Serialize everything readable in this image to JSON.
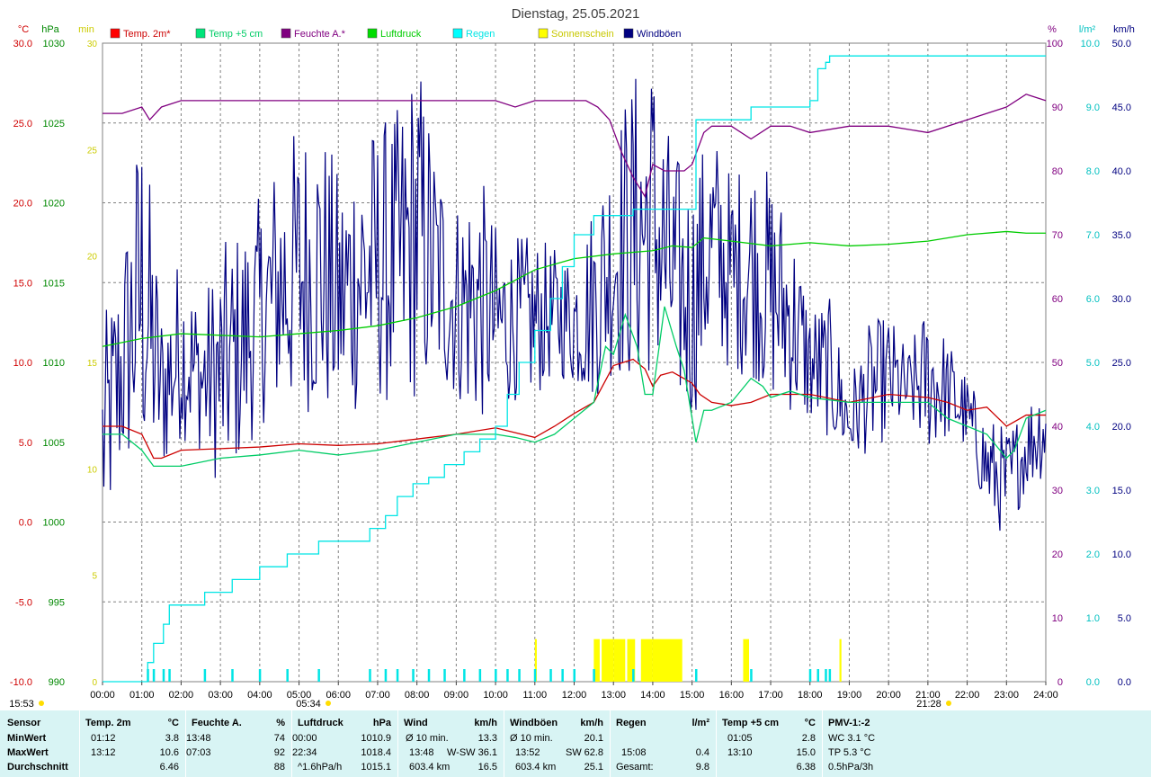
{
  "chart_data": {
    "type": "line",
    "title": "Dienstag, 25.05.2021",
    "x_ticks": [
      "00:00",
      "01:00",
      "02:00",
      "03:00",
      "04:00",
      "05:00",
      "06:00",
      "07:00",
      "08:00",
      "09:00",
      "10:00",
      "11:00",
      "12:00",
      "13:00",
      "14:00",
      "15:00",
      "16:00",
      "17:00",
      "18:00",
      "19:00",
      "20:00",
      "21:00",
      "22:00",
      "23:00",
      "24:00"
    ],
    "x_range_hours": [
      0,
      24
    ],
    "grid": true,
    "legend_placement": "top",
    "axes": {
      "temp": {
        "unit": "°C",
        "range": [
          -10,
          30
        ],
        "ticks": [
          "30.0",
          "25.0",
          "20.0",
          "15.0",
          "10.0",
          "5.0",
          "0.0",
          "-5.0",
          "-10.0"
        ],
        "color": "#ff0000"
      },
      "pressure": {
        "unit": "hPa",
        "range": [
          990,
          1030
        ],
        "ticks": [
          "1030",
          "1025",
          "1020",
          "1015",
          "1010",
          "1005",
          "1000",
          "995",
          "990"
        ],
        "color": "#00aa00"
      },
      "sun_min": {
        "unit": "min",
        "range": [
          0,
          30
        ],
        "ticks": [
          "30",
          "25",
          "20",
          "15",
          "10",
          "5",
          "0"
        ],
        "color": "#dddd00"
      },
      "humidity": {
        "unit": "%",
        "range": [
          0,
          100
        ],
        "ticks": [
          "100",
          "90",
          "80",
          "70",
          "60",
          "50",
          "40",
          "30",
          "20",
          "10",
          "0"
        ],
        "color": "#800080"
      },
      "rain": {
        "unit": "l/m²",
        "range": [
          0,
          10
        ],
        "ticks": [
          "10.0",
          "9.0",
          "8.0",
          "7.0",
          "6.0",
          "5.0",
          "4.0",
          "3.0",
          "2.0",
          "1.0",
          "0.0"
        ],
        "color": "#00cccc"
      },
      "wind": {
        "unit": "km/h",
        "range": [
          0,
          50
        ],
        "ticks": [
          "50.0",
          "45.0",
          "40.0",
          "35.0",
          "30.0",
          "25.0",
          "20.0",
          "15.0",
          "10.0",
          "5.0",
          "0.0"
        ],
        "color": "#000080"
      }
    },
    "series": [
      {
        "name": "Temp. 2m*",
        "color": "#cc0000",
        "axis": "temp",
        "x": [
          0,
          0.5,
          1,
          1.3,
          1.5,
          2,
          3,
          4,
          5,
          6,
          7,
          8,
          9,
          10,
          10.5,
          11,
          11.5,
          12,
          12.5,
          13,
          13.5,
          13.8,
          14,
          14.2,
          14.5,
          15,
          15.2,
          15.5,
          16,
          16.5,
          17,
          17.5,
          18,
          19,
          20,
          21,
          21.5,
          22,
          22.5,
          23,
          23.5,
          24
        ],
        "y": [
          6.0,
          6.0,
          5.5,
          4.0,
          4.0,
          4.5,
          4.6,
          4.7,
          4.9,
          4.8,
          4.9,
          5.2,
          5.5,
          5.9,
          5.6,
          5.3,
          6.0,
          6.8,
          7.5,
          9.8,
          10.2,
          9.6,
          8.5,
          9.2,
          9.4,
          8.7,
          8.0,
          7.5,
          7.3,
          7.5,
          8.0,
          8.0,
          8.0,
          7.5,
          8.0,
          7.8,
          7.5,
          7.0,
          7.2,
          6.0,
          6.7,
          6.7
        ]
      },
      {
        "name": "Temp +5 cm",
        "color": "#00cc66",
        "axis": "temp",
        "x": [
          0,
          0.5,
          1,
          1.3,
          2,
          3,
          4,
          5,
          6,
          7,
          8,
          9,
          10,
          10.5,
          11,
          11.5,
          12,
          12.5,
          12.8,
          13,
          13.3,
          13.6,
          13.8,
          14,
          14.3,
          14.6,
          14.8,
          15,
          15.1,
          15.3,
          15.5,
          16,
          16.5,
          16.8,
          17,
          17.5,
          18,
          19,
          20,
          21,
          21.5,
          22,
          22.5,
          23,
          23.2,
          23.5,
          24
        ],
        "y": [
          5.5,
          5.5,
          4.5,
          3.5,
          3.5,
          4.0,
          4.2,
          4.5,
          4.2,
          4.5,
          5.0,
          5.5,
          5.5,
          5.3,
          5.0,
          5.5,
          6.5,
          7.5,
          11.0,
          10.5,
          13.0,
          11.0,
          8.0,
          8.0,
          13.5,
          11.0,
          9.5,
          6.5,
          5.0,
          7.0,
          7.0,
          7.5,
          9.0,
          8.5,
          7.8,
          8.2,
          7.8,
          7.5,
          7.5,
          7.5,
          6.5,
          6.0,
          5.5,
          4.0,
          4.5,
          6.5,
          7.0
        ]
      },
      {
        "name": "Feuchte A.*",
        "color": "#800080",
        "axis": "humidity",
        "x": [
          0,
          0.5,
          1,
          1.2,
          1.5,
          2,
          3,
          4,
          5,
          6,
          7,
          8,
          9,
          10,
          10.5,
          11,
          12,
          12.3,
          12.6,
          12.9,
          13.2,
          13.5,
          13.8,
          14,
          14.3,
          14.6,
          14.8,
          15,
          15.3,
          15.5,
          16,
          16.5,
          17,
          17.5,
          18,
          19,
          20,
          21,
          22,
          23,
          23.5,
          24
        ],
        "y": [
          89,
          89,
          90,
          88,
          90,
          91,
          91,
          91,
          91,
          91,
          91,
          91,
          91,
          91,
          90,
          91,
          91,
          91,
          90,
          88,
          83,
          79,
          76,
          81,
          80,
          80,
          80,
          81,
          86,
          87,
          87,
          85,
          87,
          87,
          86,
          87,
          87,
          86,
          88,
          90,
          92,
          91
        ]
      },
      {
        "name": "Luftdruck",
        "color": "#00cc00",
        "axis": "pressure",
        "x": [
          0,
          1,
          2,
          3,
          4,
          5,
          6,
          7,
          8,
          9,
          10,
          11,
          12,
          13,
          14,
          14.5,
          15,
          15.3,
          16,
          17,
          18,
          19,
          20,
          21,
          22,
          23,
          23.5,
          24
        ],
        "y": [
          1011.0,
          1011.5,
          1011.8,
          1011.7,
          1011.6,
          1011.8,
          1012.0,
          1012.3,
          1012.8,
          1013.5,
          1014.5,
          1015.8,
          1016.5,
          1016.8,
          1017.0,
          1017.3,
          1017.2,
          1017.8,
          1017.6,
          1017.3,
          1017.5,
          1017.3,
          1017.4,
          1017.6,
          1018.0,
          1018.2,
          1018.1,
          1018.1
        ]
      },
      {
        "name": "Regen",
        "color": "#00e5e5",
        "axis": "rain",
        "x": [
          0,
          1.0,
          1.15,
          1.3,
          1.55,
          1.7,
          2.0,
          2.6,
          3.3,
          4.0,
          4.7,
          5.5,
          6.2,
          6.8,
          7.2,
          7.5,
          7.9,
          8.3,
          8.7,
          9.2,
          9.6,
          10.0,
          10.3,
          10.6,
          11.0,
          11.4,
          11.7,
          12.0,
          12.5,
          13.0,
          13.5,
          14.0,
          14.5,
          15.0,
          15.1,
          15.6,
          16.2,
          16.5,
          17.0,
          17.7,
          18.0,
          18.2,
          18.4,
          18.5,
          18.8,
          19.5,
          20.5,
          21.5,
          22.5,
          23.5,
          24
        ],
        "y": [
          0.0,
          0.0,
          0.3,
          0.6,
          0.9,
          1.2,
          1.2,
          1.4,
          1.6,
          1.8,
          2.0,
          2.2,
          2.2,
          2.4,
          2.6,
          2.9,
          3.1,
          3.2,
          3.4,
          3.6,
          3.8,
          4.0,
          4.5,
          5.0,
          5.5,
          6.0,
          6.5,
          7.0,
          7.3,
          7.3,
          7.4,
          7.4,
          7.4,
          7.4,
          8.8,
          8.8,
          8.8,
          9.0,
          9.0,
          9.0,
          9.1,
          9.6,
          9.7,
          9.8,
          9.8,
          9.8,
          9.8,
          9.8,
          9.8,
          9.8,
          9.8
        ]
      },
      {
        "name": "Windböen",
        "color": "#000080",
        "axis": "wind"
      },
      {
        "name": "Sonnenschein",
        "color": "#ffff00",
        "axis": "sun_min",
        "periods_hours": [
          [
            11.0,
            11.05
          ],
          [
            12.5,
            12.65
          ],
          [
            12.7,
            13.0
          ],
          [
            13.0,
            13.3
          ],
          [
            13.35,
            13.55
          ],
          [
            13.7,
            14.0
          ],
          [
            14.0,
            14.75
          ],
          [
            16.3,
            16.45
          ],
          [
            18.75,
            18.8
          ]
        ],
        "level_min": 2
      }
    ],
    "windboen_envelope": {
      "x": [
        0,
        0.5,
        1,
        1.5,
        2,
        2.5,
        3,
        3.5,
        4,
        4.5,
        5,
        5.5,
        6,
        6.5,
        7,
        7.5,
        8,
        8.5,
        9,
        9.5,
        10,
        10.5,
        11,
        11.5,
        12,
        12.5,
        13,
        13.5,
        14,
        14.5,
        15,
        15.5,
        16,
        16.5,
        17,
        17.5,
        18,
        18.5,
        19,
        19.5,
        20,
        20.5,
        21,
        21.5,
        22,
        22.5,
        23,
        23.5,
        24
      ],
      "low": [
        10,
        16,
        17,
        16,
        19,
        18,
        15,
        17,
        20,
        21,
        21,
        21,
        20,
        21,
        22,
        21,
        22,
        23,
        22,
        20,
        21,
        22,
        22,
        24,
        23,
        22,
        24,
        23,
        24,
        22,
        20,
        26,
        24,
        24,
        22,
        21,
        20,
        19,
        17,
        18,
        19,
        20,
        18,
        19,
        18,
        13,
        11,
        15,
        16
      ],
      "high": [
        28,
        34,
        46,
        30,
        34,
        30,
        34,
        36,
        38,
        42,
        44,
        45,
        40,
        44,
        44,
        45,
        50,
        42,
        38,
        41,
        36,
        35,
        35,
        34,
        34,
        38,
        44,
        48,
        50,
        42,
        40,
        44,
        40,
        42,
        40,
        37,
        30,
        30,
        24,
        28,
        29,
        26,
        30,
        27,
        24,
        21,
        20,
        22,
        25
      ]
    },
    "markers": [
      "05:34",
      "21:28",
      "15:53"
    ]
  },
  "stats": {
    "headers": {
      "sensor": "Sensor",
      "temp": "Temp. 2m",
      "temp_unit": "°C",
      "hum": "Feuchte A.",
      "hum_unit": "%",
      "press": "Luftdruck",
      "press_unit": "hPa",
      "wind": "Wind",
      "wind_unit": "km/h",
      "gust": "Windböen",
      "gust_unit": "km/h",
      "rain": "Regen",
      "rain_unit": "l/m²",
      "t5": "Temp +5 cm",
      "t5_unit": "°C",
      "pmv": "PMV-1:-2"
    },
    "rows": {
      "min": {
        "label": "MinWert",
        "temp_t": "01:12",
        "temp_v": "3.8",
        "hum_t": "13:48",
        "hum_v": "74",
        "press_t": "00:00",
        "press_v": "1010.9",
        "wind_t": "Ø 10 min.",
        "wind_v": "13.3",
        "gust_t": "Ø 10 min.",
        "gust_v": "20.1",
        "rain_t": "",
        "rain_v": "",
        "t5_t": "01:05",
        "t5_v": "2.8",
        "pmv": "WC 3.1 °C"
      },
      "max": {
        "label": "MaxWert",
        "temp_t": "13:12",
        "temp_v": "10.6",
        "hum_t": "07:03",
        "hum_v": "92",
        "press_t": "22:34",
        "press_v": "1018.4",
        "wind_t": "13:48",
        "wind_dir": "W-SW",
        "wind_v": "36.1",
        "gust_t": "13:52",
        "gust_dir": "SW",
        "gust_v": "62.8",
        "rain_t": "15:08",
        "rain_v": "0.4",
        "t5_t": "13:10",
        "t5_v": "15.0",
        "pmv": "TP 5.3 °C"
      },
      "avg": {
        "label": "Durchschnitt",
        "temp_v": "6.46",
        "hum_v": "88",
        "press_t": "^1.6hPa/h",
        "press_v": "1015.1",
        "wind_t": "603.4 km",
        "wind_v": "16.5",
        "gust_t": "603.4 km",
        "gust_v": "25.1",
        "rain_t": "Gesamt:",
        "rain_v": "9.8",
        "t5_v": "6.38",
        "pmv": "0.5hPa/3h"
      }
    }
  }
}
